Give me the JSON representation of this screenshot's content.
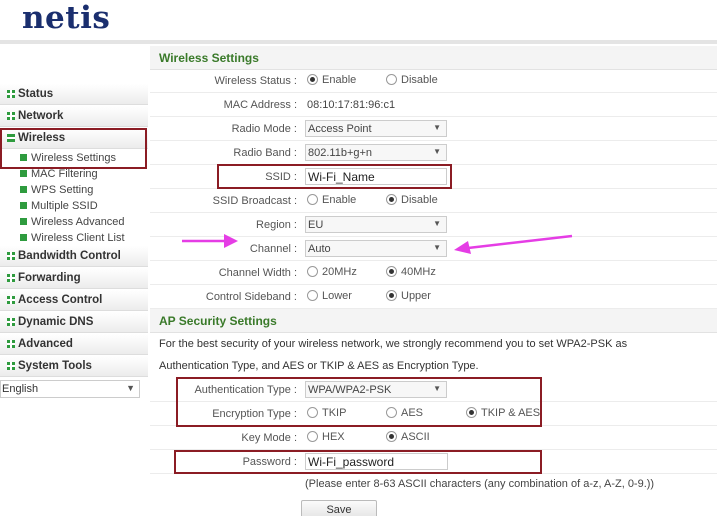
{
  "brand": {
    "logo_text": "netis",
    "accent": "#1a2e6e",
    "green": "#2e9b3e",
    "highlight_color": "#8b1c24",
    "arrow_color": "#e53de5"
  },
  "sidebar": {
    "items": [
      {
        "label": "Status",
        "icon": "plus-square-icon"
      },
      {
        "label": "Network",
        "icon": "plus-square-icon"
      },
      {
        "label": "Wireless",
        "icon": "minus-square-icon",
        "expanded": true
      },
      {
        "label": "Bandwidth Control",
        "icon": "plus-square-icon"
      },
      {
        "label": "Forwarding",
        "icon": "plus-square-icon"
      },
      {
        "label": "Access Control",
        "icon": "plus-square-icon"
      },
      {
        "label": "Dynamic DNS",
        "icon": "plus-square-icon"
      },
      {
        "label": "Advanced",
        "icon": "plus-square-icon"
      },
      {
        "label": "System Tools",
        "icon": "plus-square-icon"
      }
    ],
    "wireless_sub": [
      {
        "label": "Wireless Settings",
        "selected": true
      },
      {
        "label": "MAC Filtering"
      },
      {
        "label": "WPS Setting"
      },
      {
        "label": "Multiple SSID"
      },
      {
        "label": "Wireless Advanced"
      },
      {
        "label": "Wireless Client List"
      }
    ],
    "language": "English"
  },
  "wireless": {
    "title": "Wireless Settings",
    "status_label": "Wireless Status :",
    "status_enable": "Enable",
    "status_disable": "Disable",
    "status_value": "Enable",
    "mac_label": "MAC Address :",
    "mac_value": "08:10:17:81:96:c1",
    "mode_label": "Radio Mode :",
    "mode_value": "Access Point",
    "band_label": "Radio Band :",
    "band_value": "802.11b+g+n",
    "ssid_label": "SSID :",
    "ssid_value": "Wi-Fi_Name",
    "broadcast_label": "SSID Broadcast :",
    "broadcast_enable": "Enable",
    "broadcast_disable": "Disable",
    "broadcast_value": "Disable",
    "region_label": "Region :",
    "region_value": "EU",
    "channel_label": "Channel :",
    "channel_value": "Auto",
    "width_label": "Channel Width :",
    "width_20": "20MHz",
    "width_40": "40MHz",
    "width_value": "40MHz",
    "sideband_label": "Control Sideband :",
    "sideband_lower": "Lower",
    "sideband_upper": "Upper",
    "sideband_value": "Upper"
  },
  "security": {
    "title": "AP Security Settings",
    "note_line1": "For the best security of your wireless network, we strongly recommend you to set WPA2-PSK as",
    "note_line2": "Authentication Type, and AES or TKIP & AES as Encryption Type.",
    "auth_label": "Authentication Type :",
    "auth_value": "WPA/WPA2-PSK",
    "enc_label": "Encryption Type :",
    "enc_tkip": "TKIP",
    "enc_aes": "AES",
    "enc_both": "TKIP & AES",
    "enc_value": "TKIP & AES",
    "key_label": "Key Mode :",
    "key_hex": "HEX",
    "key_ascii": "ASCII",
    "key_value": "ASCII",
    "password_label": "Password :",
    "password_value": "Wi-Fi_password",
    "password_hint": "(Please enter 8-63 ASCII characters (any combination of a-z, A-Z, 0-9.))"
  },
  "actions": {
    "save_label": "Save"
  }
}
